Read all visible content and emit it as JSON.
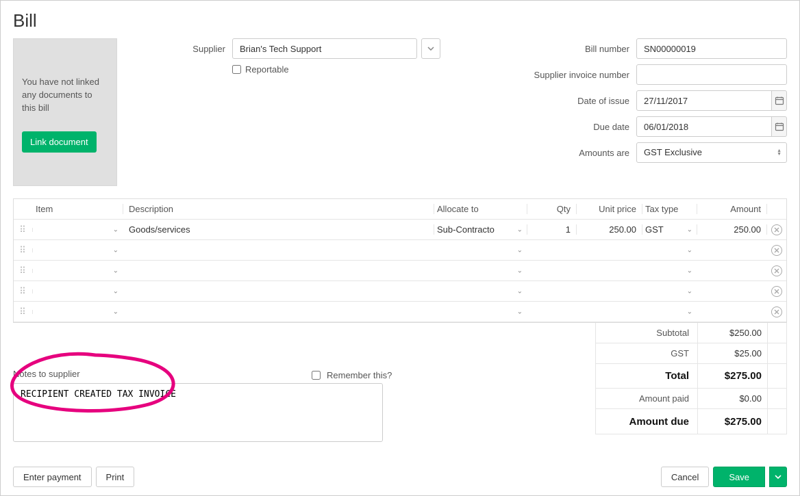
{
  "page_title": "Bill",
  "doc_box": {
    "message": "You have not linked any documents to this bill",
    "link_button": "Link document"
  },
  "form": {
    "supplier_label": "Supplier",
    "supplier_value": "Brian's Tech Support",
    "reportable_label": "Reportable",
    "bill_number_label": "Bill number",
    "bill_number_value": "SN00000019",
    "supplier_invoice_label": "Supplier invoice number",
    "supplier_invoice_value": "",
    "date_of_issue_label": "Date of issue",
    "date_of_issue_value": "27/11/2017",
    "due_date_label": "Due date",
    "due_date_value": "06/01/2018",
    "amounts_are_label": "Amounts are",
    "amounts_are_value": "GST Exclusive"
  },
  "grid": {
    "headers": {
      "item": "Item",
      "description": "Description",
      "allocate_to": "Allocate to",
      "qty": "Qty",
      "unit_price": "Unit price",
      "tax_type": "Tax type",
      "amount": "Amount"
    },
    "rows": [
      {
        "item": "",
        "description": "Goods/services",
        "allocate_to": "Sub-Contracto",
        "qty": "1",
        "unit_price": "250.00",
        "tax": "GST",
        "amount": "250.00"
      },
      {
        "item": "",
        "description": "",
        "allocate_to": "",
        "qty": "",
        "unit_price": "",
        "tax": "",
        "amount": ""
      },
      {
        "item": "",
        "description": "",
        "allocate_to": "",
        "qty": "",
        "unit_price": "",
        "tax": "",
        "amount": ""
      },
      {
        "item": "",
        "description": "",
        "allocate_to": "",
        "qty": "",
        "unit_price": "",
        "tax": "",
        "amount": ""
      },
      {
        "item": "",
        "description": "",
        "allocate_to": "",
        "qty": "",
        "unit_price": "",
        "tax": "",
        "amount": ""
      }
    ]
  },
  "totals": {
    "subtotal_label": "Subtotal",
    "subtotal_value": "$250.00",
    "gst_label": "GST",
    "gst_value": "$25.00",
    "total_label": "Total",
    "total_value": "$275.00",
    "paid_label": "Amount paid",
    "paid_value": "$0.00",
    "due_label": "Amount due",
    "due_value": "$275.00"
  },
  "notes": {
    "label": "Notes to supplier",
    "value": "RECIPIENT CREATED TAX INVOICE",
    "remember_label": "Remember this?"
  },
  "footer": {
    "enter_payment": "Enter payment",
    "print": "Print",
    "cancel": "Cancel",
    "save": "Save"
  }
}
